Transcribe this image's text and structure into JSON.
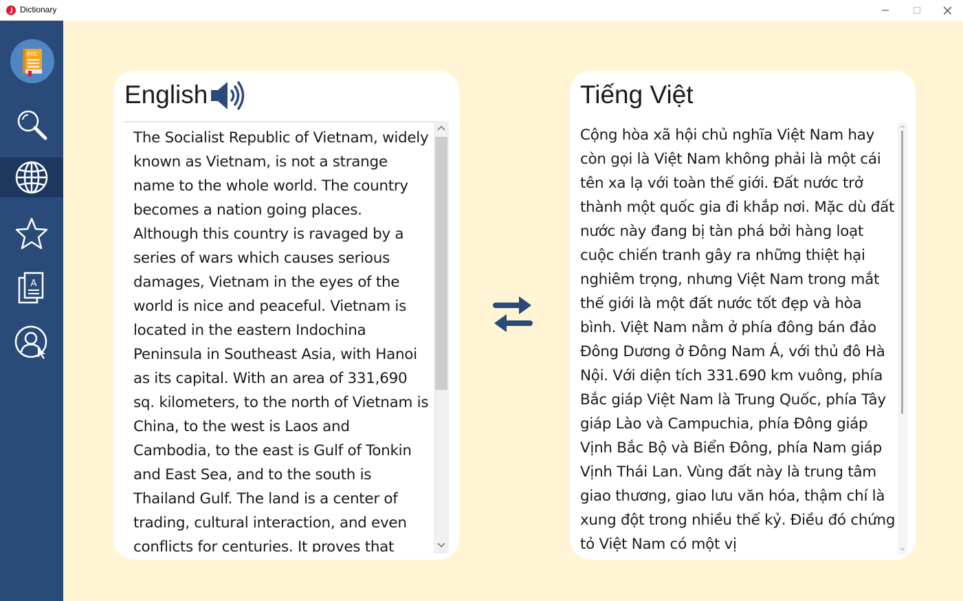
{
  "window": {
    "title": "Dictionary",
    "controls": [
      "minimize-icon",
      "maximize-icon",
      "close-icon"
    ]
  },
  "sidebar": {
    "logo": "dictionary-book-icon",
    "items": [
      {
        "name": "search",
        "icon": "magnifier-icon",
        "active": false
      },
      {
        "name": "translate",
        "icon": "globe-icon",
        "active": true
      },
      {
        "name": "favorites",
        "icon": "star-icon",
        "active": false
      },
      {
        "name": "flashcards",
        "icon": "cards-icon",
        "active": false
      },
      {
        "name": "account",
        "icon": "user-icon",
        "active": false
      }
    ]
  },
  "source": {
    "language": "English",
    "speaker_icon": "speaker-icon",
    "text": "The Socialist Republic of Vietnam, widely known as Vietnam, is not a strange name to the whole world. The country becomes a nation going places. Although this country is ravaged by a series of wars which causes serious damages, Vietnam in the eyes of the world is nice and peaceful. Vietnam is located in the eastern Indochina Peninsula in Southeast Asia, with Hanoi as its capital. With an area of 331,690 sq. kilometers, to the north of Vietnam is China, to the west is Laos and Cambodia, to the east is Gulf of Tonkin and East Sea, and to the south is Thailand Gulf. The land is a center of trading, cultural interaction, and even conflicts for centuries. It proves that"
  },
  "target": {
    "language": "Tiếng Việt",
    "text": "Cộng hòa xã hội chủ nghĩa Việt Nam hay còn gọi là Việt Nam không phải là một cái tên xa lạ với toàn thế giới. Đất nước trở thành một quốc gia đi khắp nơi. Mặc dù đất nước này đang bị tàn phá bởi hàng loạt cuộc chiến tranh gây ra những thiệt hại nghiêm trọng, nhưng Việt Nam trong mắt thế giới là một đất nước tốt đẹp và hòa bình. Việt Nam nằm ở phía đông bán đảo Đông Dương ở Đông Nam Á, với thủ đô Hà Nội. Với diện tích 331.690 km vuông, phía Bắc giáp Việt Nam là Trung Quốc, phía Tây giáp Lào và Campuchia, phía Đông giáp Vịnh Bắc Bộ và Biển Đông, phía Nam giáp Vịnh Thái Lan. Vùng đất này là trung tâm giao thương, giao lưu văn hóa, thậm chí là xung đột trong nhiều thế kỷ. Điều đó chứng tỏ Việt Nam có một vị"
  },
  "swap_icon": "swap-arrows-icon",
  "colors": {
    "sidebar": "#2a4a7a",
    "sidebar_active": "#1d3760",
    "background": "#fff4d4",
    "accent": "#2a4a7a"
  }
}
